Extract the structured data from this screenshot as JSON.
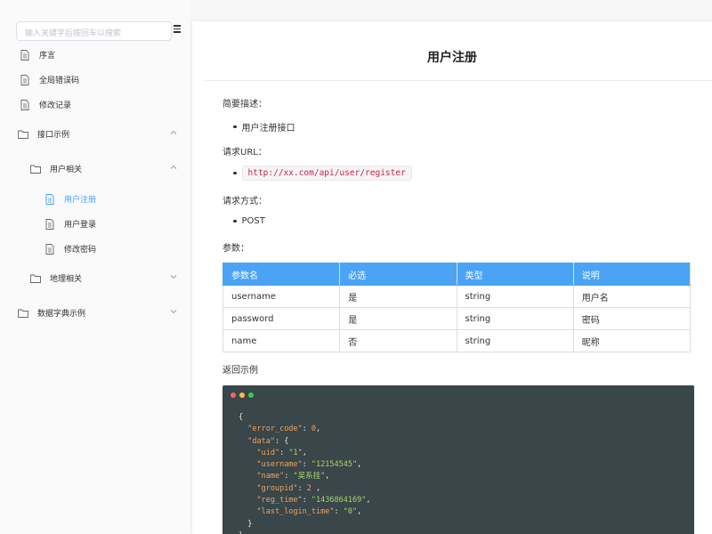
{
  "sidebar": {
    "search_placeholder": "输入关键字后按回车以搜索",
    "items": [
      {
        "label": "序言"
      },
      {
        "label": "全局错误码"
      },
      {
        "label": "修改记录"
      },
      {
        "label": "接口示例"
      },
      {
        "label": "用户相关"
      },
      {
        "label": "用户注册"
      },
      {
        "label": "用户登录"
      },
      {
        "label": "修改密码"
      },
      {
        "label": "地理相关"
      },
      {
        "label": "数据字典示例"
      }
    ]
  },
  "main": {
    "title": "用户注册",
    "desc_label": "简要描述：",
    "desc_value": "用户注册接口",
    "url_label": "请求URL：",
    "url_value": "http://xx.com/api/user/register",
    "method_label": "请求方式：",
    "method_value": "POST",
    "params_label": "参数：",
    "table": {
      "headers": [
        "参数名",
        "必选",
        "类型",
        "说明"
      ],
      "rows": [
        [
          "username",
          "是",
          "string",
          "用户名"
        ],
        [
          "password",
          "是",
          "string",
          "密码"
        ],
        [
          "name",
          "否",
          "string",
          "昵称"
        ]
      ]
    },
    "return_label": "返回示例",
    "code": {
      "open_brace": "{",
      "error_code_key": "\"error_code\"",
      "error_code_val": "0",
      "data_key": "\"data\"",
      "uid_key": "\"uid\"",
      "uid_val": "\"1\"",
      "username_key": "\"username\"",
      "username_val": "\"12154545\"",
      "name_key": "\"name\"",
      "name_val": "\"吴系挂\"",
      "groupid_key": "\"groupid\"",
      "groupid_val": "2",
      "reg_time_key": "\"reg_time\"",
      "reg_time_val": "\"1436864169\"",
      "last_login_key": "\"last_login_time\"",
      "last_login_val": "\"0\"",
      "close_inner": "}",
      "close_outer": "}"
    }
  },
  "colors": {
    "accent": "#409eff",
    "table_header": "#4aa3f5",
    "code_bg": "#39464a",
    "dot_red": "#fc625d",
    "dot_yellow": "#fdbc40",
    "dot_green": "#35cd4b"
  }
}
